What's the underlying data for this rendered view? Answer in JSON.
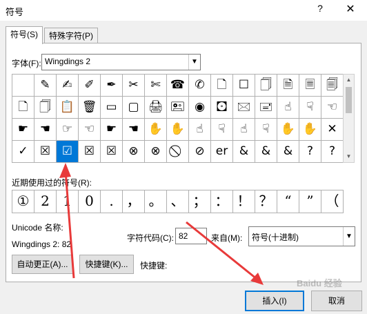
{
  "window": {
    "title": "符号",
    "help": "?",
    "close": "✕"
  },
  "tabs": [
    {
      "label": "符号(S)",
      "active": true
    },
    {
      "label": "特殊字符(P)",
      "active": false
    }
  ],
  "font": {
    "label": "字体(F):",
    "value": "Wingdings 2"
  },
  "symbol_grid": {
    "rows": [
      [
        "",
        "✎",
        "✍",
        "✐",
        "✒",
        "✂",
        "✄",
        "☎",
        "✆",
        "🗋",
        "☐",
        "🗍",
        "🗎",
        "🗏",
        "🗐"
      ],
      [
        "🗋",
        "🗍",
        "📋",
        "🗑",
        "▭",
        "▢",
        "🖨",
        "🖭",
        "◉",
        "🖸",
        "🖂",
        "🖃",
        "☝",
        "☟",
        "☜"
      ],
      [
        "☛",
        "☚",
        "☞",
        "☜",
        "☛",
        "☚",
        "✋",
        "✋",
        "☝",
        "☟",
        "☝",
        "☟",
        "✋",
        "✋",
        "✕"
      ],
      [
        "✓",
        "☒",
        "☑",
        "☒",
        "☒",
        "⊗",
        "⊗",
        "⃠",
        "⊘",
        "er",
        "&",
        "&",
        "&",
        "?",
        "?"
      ]
    ],
    "last_cell": "?",
    "selected": {
      "row": 3,
      "col": 2
    }
  },
  "recent": {
    "label": "近期使用过的符号(R):",
    "symbols": [
      "①",
      "2",
      "1",
      "0",
      ".",
      "，",
      "。",
      "、",
      "；",
      "：",
      "！",
      "？",
      "“",
      "”",
      "（",
      "【"
    ]
  },
  "unicode": {
    "name_label": "Unicode 名称:",
    "info": "Wingdings 2: 82"
  },
  "char_code": {
    "label": "字符代码(C):",
    "value": "82"
  },
  "from": {
    "label": "来自(M):",
    "value": "符号(十进制)"
  },
  "buttons": {
    "autocorrect": "自动更正(A)...",
    "shortcut_key": "快捷键(K)...",
    "shortcut_label": "快捷键:",
    "insert": "插入(I)",
    "cancel": "取消"
  },
  "watermark": "Baidu 经验",
  "colors": {
    "selection": "#0078d7",
    "arrow": "#e83a3a"
  }
}
